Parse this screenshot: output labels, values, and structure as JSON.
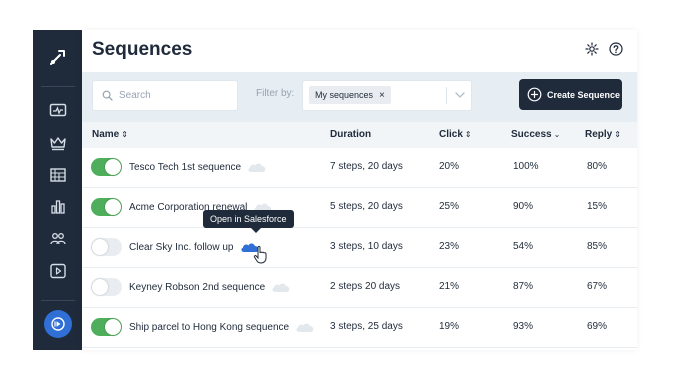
{
  "app": {
    "title": "Sequences",
    "accent": "#2f6fd6",
    "sidebar_bg": "#1f2a3a",
    "toggle_on_color": "#4fae5b"
  },
  "sidebar": {
    "logo_icon": "pen-nib-icon",
    "items": [
      {
        "icon": "activity-monitor-icon"
      },
      {
        "icon": "crown-icon"
      },
      {
        "icon": "building-icon"
      },
      {
        "icon": "bar-chart-icon"
      },
      {
        "icon": "users-icon"
      },
      {
        "icon": "play-icon"
      }
    ],
    "bottom_icon": "sequence-play-icon"
  },
  "header_icons": [
    "gear-icon",
    "help-icon"
  ],
  "filters": {
    "search_placeholder": "Search",
    "search_value": "",
    "filter_label": "Filter by:",
    "chip_label": "My sequences",
    "chip_remove": "×",
    "create_button": "Create Sequence"
  },
  "table": {
    "columns": {
      "name": "Name",
      "duration": "Duration",
      "click": "Click",
      "success": "Success",
      "reply": "Reply"
    },
    "rows": [
      {
        "enabled": true,
        "name": "Tesco Tech 1st sequence",
        "duration": "7 steps, 20 days",
        "click": "20%",
        "success": "100%",
        "reply": "80%"
      },
      {
        "enabled": true,
        "name": "Acme Corporation renewal",
        "duration": "5 steps, 20 days",
        "click": "25%",
        "success": "90%",
        "reply": "15%"
      },
      {
        "enabled": false,
        "name": "Clear Sky Inc. follow up",
        "duration": "3 steps, 10 days",
        "click": "23%",
        "success": "54%",
        "reply": "85%"
      },
      {
        "enabled": false,
        "name": "Keyney Robson 2nd sequence",
        "duration": "2 steps 20 days",
        "click": "21%",
        "success": "87%",
        "reply": "67%"
      },
      {
        "enabled": true,
        "name": "Ship parcel to Hong Kong sequence",
        "duration": "3 steps, 25 days",
        "click": "19%",
        "success": "93%",
        "reply": "69%"
      }
    ]
  },
  "tooltip": {
    "text": "Open in Salesforce"
  }
}
